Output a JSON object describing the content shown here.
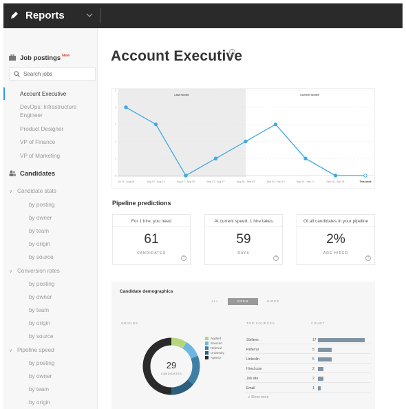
{
  "header": {
    "title": "Reports"
  },
  "sidebar": {
    "job_postings": {
      "label": "Job postings",
      "badge": "New"
    },
    "search": {
      "placeholder": "Search jobs"
    },
    "jobs": [
      {
        "label": "Account Executive"
      },
      {
        "label": "DevOps: Infrastructure Engineer"
      },
      {
        "label": "Product Designer"
      },
      {
        "label": "VP of Finance"
      },
      {
        "label": "VP of Marketing"
      }
    ],
    "candidates": {
      "label": "Candidates"
    },
    "groups": [
      {
        "label": "Candidate stats",
        "items": [
          "by posting",
          "by owner",
          "by team",
          "by origin",
          "by source"
        ]
      },
      {
        "label": "Conversion rates",
        "items": [
          "by posting",
          "by owner",
          "by team",
          "by origin",
          "by source"
        ]
      },
      {
        "label": "Pipeline speed",
        "items": [
          "by posting",
          "by owner",
          "by team",
          "by origin"
        ]
      }
    ]
  },
  "main": {
    "title": "Account Executive",
    "pipeline_title": "Pipeline predictions",
    "cards": [
      {
        "header": "For 1 hire, you need",
        "value": "61",
        "caption": "CANDIDATES"
      },
      {
        "header": "At current speed, 1 hire takes",
        "value": "59",
        "caption": "DAYS"
      },
      {
        "header": "Of all candidates in your pipeline",
        "value": "2%",
        "caption": "ARE HIRED"
      }
    ],
    "demographics": {
      "title": "Candidate demographics",
      "segments": [
        "ALL",
        "OPEN",
        "HIRED"
      ],
      "selected_segment": "OPEN",
      "col_origins": "ORIGINS",
      "col_top_sources": "TOP SOURCES",
      "col_count": "COUNT",
      "donut_value": "29",
      "donut_caption": "CANDIDATES",
      "legend": [
        {
          "label": "Applied",
          "color": "#b5d67a"
        },
        {
          "label": "Sourced",
          "color": "#6fb6e0"
        },
        {
          "label": "Referral",
          "color": "#3f7fa6"
        },
        {
          "label": "University",
          "color": "#2c5e7e"
        },
        {
          "label": "Agency",
          "color": "#2a2a2a"
        }
      ],
      "sources": [
        {
          "name": "Stellens",
          "count": "17",
          "value": 17
        },
        {
          "name": "Referral",
          "count": "5",
          "value": 5
        },
        {
          "name": "LinkedIn",
          "count": "5",
          "value": 5
        },
        {
          "name": "Hired.com",
          "count": "2",
          "value": 2
        },
        {
          "name": "Job site",
          "count": "2",
          "value": 2
        },
        {
          "name": "Email",
          "count": "1",
          "value": 1
        }
      ],
      "show_more": "Show more"
    }
  },
  "chart_data": {
    "type": "line",
    "x": [
      "Jul 31 - Aug 06",
      "Aug 07 - Aug 13",
      "Aug 14 - Aug 20",
      "Aug 21 - Aug 27",
      "Aug 28 - Sep 03",
      "Sep 04 - Sep 10",
      "Sep 11 - Sep 17",
      "Sep 18 - Sep 24",
      "This week"
    ],
    "series": [
      {
        "values": [
          4,
          3,
          0,
          1,
          2,
          3,
          1,
          0,
          0
        ]
      }
    ],
    "region_labels": [
      "Last month",
      "Current month"
    ],
    "y_ticks": [
      "0",
      "1",
      "2",
      "3",
      "4",
      "5"
    ],
    "ylim": [
      0,
      5
    ],
    "line_color": "#3fa9e0"
  }
}
